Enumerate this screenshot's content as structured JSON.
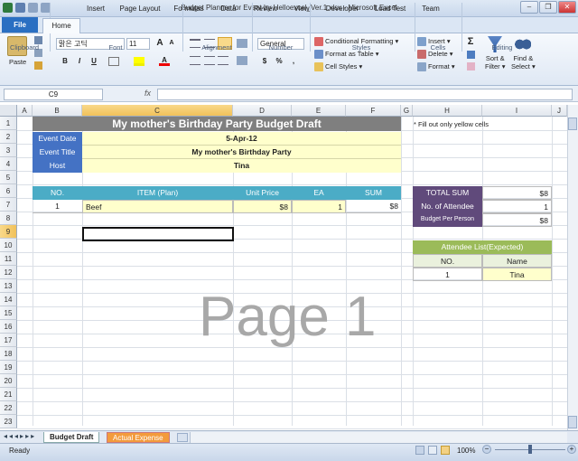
{
  "window": {
    "title": "Budget Planner for Event by Helloexcel_Ver.1.xlsx  -  Microsoft Excel",
    "controls": [
      "–",
      "❐",
      "✕"
    ]
  },
  "ribbon_tabs": {
    "file": "File",
    "tabs": [
      "Home",
      "Insert",
      "Page Layout",
      "Formulas",
      "Data",
      "Review",
      "View",
      "Developer",
      "Load Test",
      "Team"
    ]
  },
  "ribbon": {
    "clipboard": {
      "paste": "Paste",
      "label": "Clipboard"
    },
    "font": {
      "name": "맑은 고딕",
      "size": "11",
      "label": "Font",
      "bold": "B",
      "italic": "I",
      "underline": "U",
      "grow": "A",
      "shrink": "A"
    },
    "alignment": {
      "label": "Alignment"
    },
    "number": {
      "format": "General",
      "label": "Number",
      "currency": "$",
      "percent": "%",
      "comma": ","
    },
    "styles": {
      "cond": "Conditional Formatting",
      "table": "Format as Table",
      "cell": "Cell Styles",
      "label": "Styles"
    },
    "cells": {
      "insert": "Insert",
      "delete": "Delete",
      "format": "Format",
      "label": "Cells"
    },
    "editing": {
      "sum": "Σ",
      "sort": "Sort &",
      "sort2": "Filter",
      "find": "Find &",
      "find2": "Select",
      "label": "Editing"
    }
  },
  "formula_bar": {
    "name_box": "C9",
    "fx": "fx",
    "value": ""
  },
  "columns": [
    "A",
    "B",
    "C",
    "D",
    "E",
    "F",
    "G",
    "H",
    "I",
    "J"
  ],
  "rows": [
    "1",
    "2",
    "3",
    "4",
    "5",
    "6",
    "7",
    "8",
    "9",
    "10",
    "11",
    "12",
    "13",
    "14",
    "15",
    "16",
    "17",
    "18",
    "19",
    "20",
    "21",
    "22",
    "23"
  ],
  "sheet": {
    "title": "My mother's Birthday Party Budget Draft",
    "note": "* Fill out only yellow cells",
    "info": {
      "date_label": "Event Date",
      "date": "5-Apr-12",
      "title_label": "Event Title",
      "title": "My mother's Birthday Party",
      "host_label": "Host",
      "host": "Tina"
    },
    "table_headers": [
      "NO.",
      "ITEM (Plan)",
      "Unit Price",
      "EA",
      "SUM"
    ],
    "rows": [
      {
        "no": "1",
        "item": "Beef",
        "price": "$8",
        "ea": "1",
        "sum": "$8"
      }
    ],
    "summary": {
      "total_label": "TOTAL SUM",
      "total": "$8",
      "attendee_label": "No. of Attendee",
      "attendee": "1",
      "per_label": "Budget Per Person",
      "per": "$8"
    },
    "attendee": {
      "title": "Attendee List(Expected)",
      "no_label": "NO.",
      "name_label": "Name",
      "no": "1",
      "name": "Tina"
    },
    "watermark": "Page 1"
  },
  "sheet_tabs": [
    "Budget Draft",
    "Actual Expense"
  ],
  "status": {
    "ready": "Ready",
    "zoom": "100%"
  },
  "colors": {
    "title_bg": "#7f7f7f",
    "label_blue": "#4472c4",
    "header_teal": "#4bacc6",
    "yellow": "#ffffcc",
    "summary_purple": "#604a7b",
    "green": "#9bbb59"
  }
}
